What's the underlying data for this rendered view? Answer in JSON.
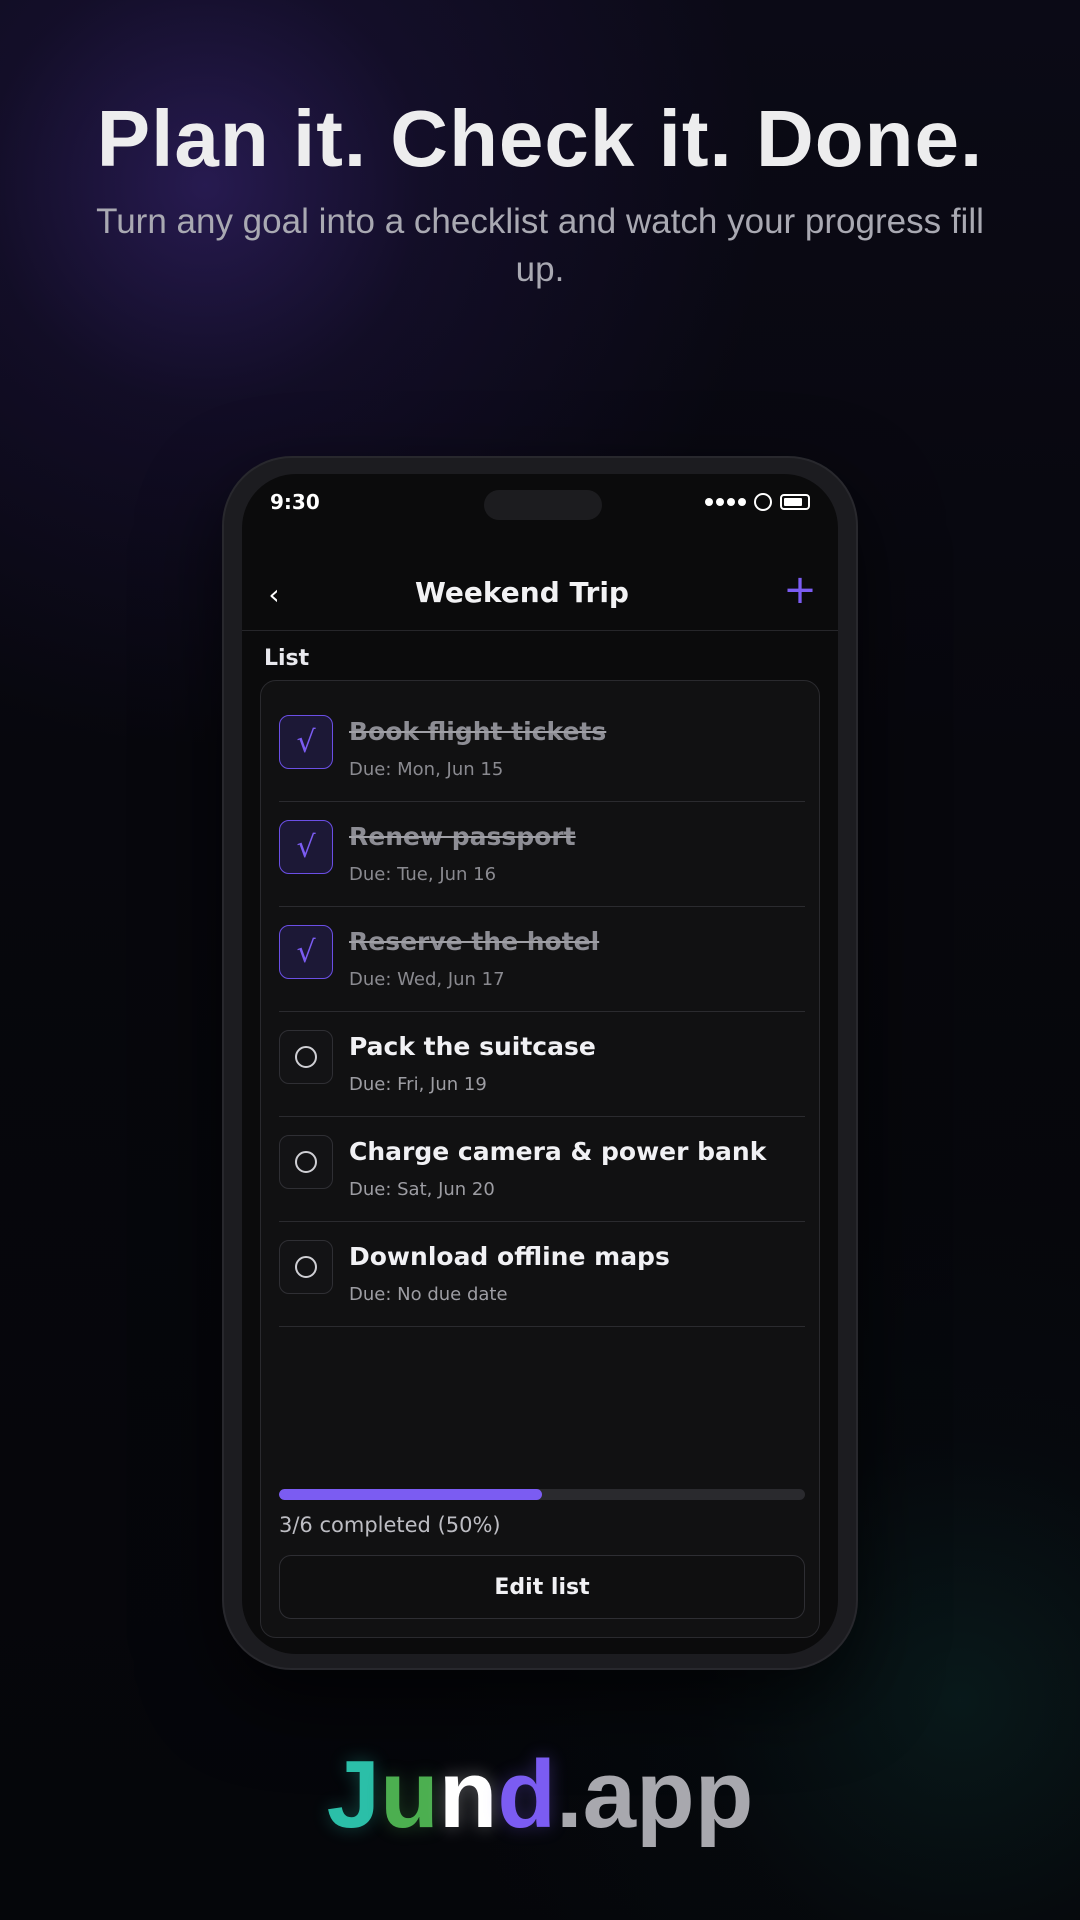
{
  "hero": {
    "title": "Plan it. Check it. Done.",
    "subtitle": "Turn any goal into a checklist and watch your progress fill up."
  },
  "status_bar": {
    "time": "9:30",
    "icons": [
      "signal-dots-icon",
      "circle-icon",
      "battery-icon"
    ]
  },
  "nav": {
    "back_label": "‹",
    "title": "Weekend Trip",
    "add_label": "+"
  },
  "list": {
    "section_label": "List",
    "check_glyph": "√",
    "items": [
      {
        "title": "Book flight tickets",
        "due": "Due: Mon, Jun 15",
        "done": true
      },
      {
        "title": "Renew passport",
        "due": "Due: Tue, Jun 16",
        "done": true
      },
      {
        "title": "Reserve the hotel",
        "due": "Due: Wed, Jun 17",
        "done": true
      },
      {
        "title": "Pack the suitcase",
        "due": "Due: Fri, Jun 19",
        "done": false
      },
      {
        "title": "Charge camera & power bank",
        "due": "Due: Sat, Jun 20",
        "done": false
      },
      {
        "title": "Download offline maps",
        "due": "Due: No due date",
        "done": false
      }
    ]
  },
  "progress": {
    "fraction": 0.5,
    "text": "3/6 completed (50%)",
    "edit_label": "Edit list"
  },
  "brand": {
    "parts": [
      {
        "text": "J",
        "color": "#2bbfa8"
      },
      {
        "text": "u",
        "color": "#4caf50"
      },
      {
        "text": "n",
        "color": "#ffffff"
      },
      {
        "text": "d",
        "color": "#7b5cf2"
      },
      {
        "text": ".app",
        "color": "#a8a8ae"
      }
    ]
  },
  "colors": {
    "accent": "#7b5cf2",
    "background": "#06070b",
    "card": "#111112"
  }
}
